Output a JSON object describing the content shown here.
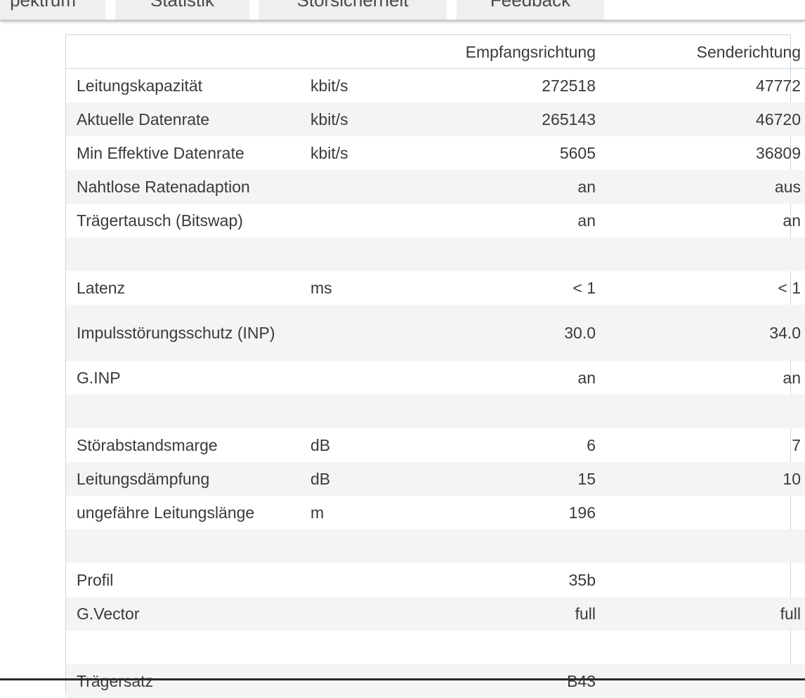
{
  "tabs": [
    "pektrum",
    "Statistik",
    "Störsicherheit",
    "Feedback"
  ],
  "table": {
    "headers": [
      "",
      "",
      "Empfangsrichtung",
      "Senderichtung"
    ],
    "rows": [
      {
        "label": "Leitungskapazität",
        "unit": "kbit/s",
        "rx": "272518",
        "tx": "47772"
      },
      {
        "label": "Aktuelle Datenrate",
        "unit": "kbit/s",
        "rx": "265143",
        "tx": "46720"
      },
      {
        "label": "Min Effektive Datenrate",
        "unit": "kbit/s",
        "rx": "5605",
        "tx": "36809"
      },
      {
        "label": "Nahtlose Ratenadaption",
        "unit": "",
        "rx": "an",
        "tx": "aus"
      },
      {
        "label": "Trägertausch (Bitswap)",
        "unit": "",
        "rx": "an",
        "tx": "an"
      },
      {
        "label": "",
        "unit": "",
        "rx": "",
        "tx": ""
      },
      {
        "label": "Latenz",
        "unit": "ms",
        "rx": "< 1",
        "tx": "< 1"
      },
      {
        "label": "Impulsstörungsschutz (INP)",
        "unit": "",
        "rx": "30.0",
        "tx": "34.0"
      },
      {
        "label": "G.INP",
        "unit": "",
        "rx": "an",
        "tx": "an"
      },
      {
        "label": "",
        "unit": "",
        "rx": "",
        "tx": ""
      },
      {
        "label": "Störabstandsmarge",
        "unit": "dB",
        "rx": "6",
        "tx": "7"
      },
      {
        "label": "Leitungsdämpfung",
        "unit": "dB",
        "rx": "15",
        "tx": "10"
      },
      {
        "label": "ungefähre Leitungslänge",
        "unit": "m",
        "rx": "196",
        "tx": ""
      },
      {
        "label": "",
        "unit": "",
        "rx": "",
        "tx": ""
      },
      {
        "label": "Profil",
        "unit": "",
        "rx": "35b",
        "tx": ""
      },
      {
        "label": "G.Vector",
        "unit": "",
        "rx": "full",
        "tx": "full"
      },
      {
        "label": "",
        "unit": "",
        "rx": "",
        "tx": ""
      },
      {
        "label": "Trägersatz",
        "unit": "",
        "rx": "B43",
        "tx": ""
      }
    ]
  }
}
